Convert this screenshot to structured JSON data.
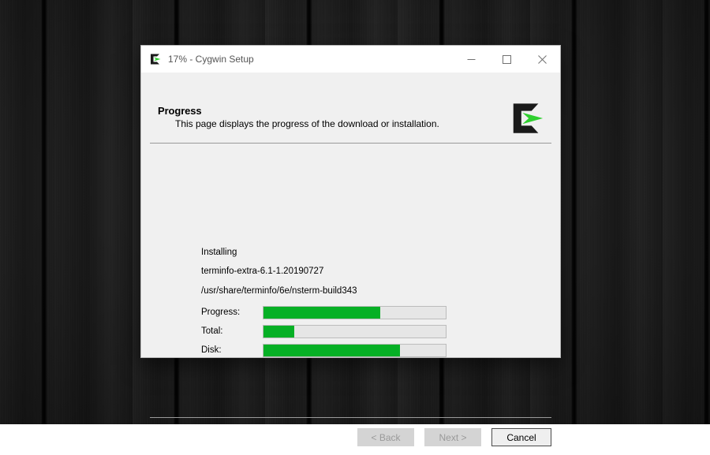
{
  "desktop": {
    "background_description": "dark-wood-planks",
    "background_color": "#1d1d1d"
  },
  "window": {
    "titlebar": {
      "icon": "cygwin-icon",
      "title": "17% - Cygwin Setup",
      "controls": {
        "minimize": "minimize-icon",
        "maximize": "maximize-icon",
        "close": "close-icon"
      }
    },
    "header": {
      "title": "Progress",
      "subtitle": "This page displays the progress of the download or installation.",
      "logo": "cygwin-logo"
    },
    "content": {
      "status_lines": [
        "Installing",
        "terminfo-extra-6.1-1.20190727",
        "/usr/share/terminfo/6e/nsterm-build343"
      ],
      "progress_bars": [
        {
          "label": "Progress:",
          "percent": 64,
          "color": "#06b025"
        },
        {
          "label": "Total:",
          "percent": 17,
          "color": "#06b025"
        },
        {
          "label": "Disk:",
          "percent": 75,
          "color": "#06b025"
        }
      ]
    },
    "footer": {
      "buttons": [
        {
          "label": "< Back",
          "state": "disabled"
        },
        {
          "label": "Next >",
          "state": "disabled"
        },
        {
          "label": "Cancel",
          "state": "enabled"
        }
      ]
    }
  }
}
